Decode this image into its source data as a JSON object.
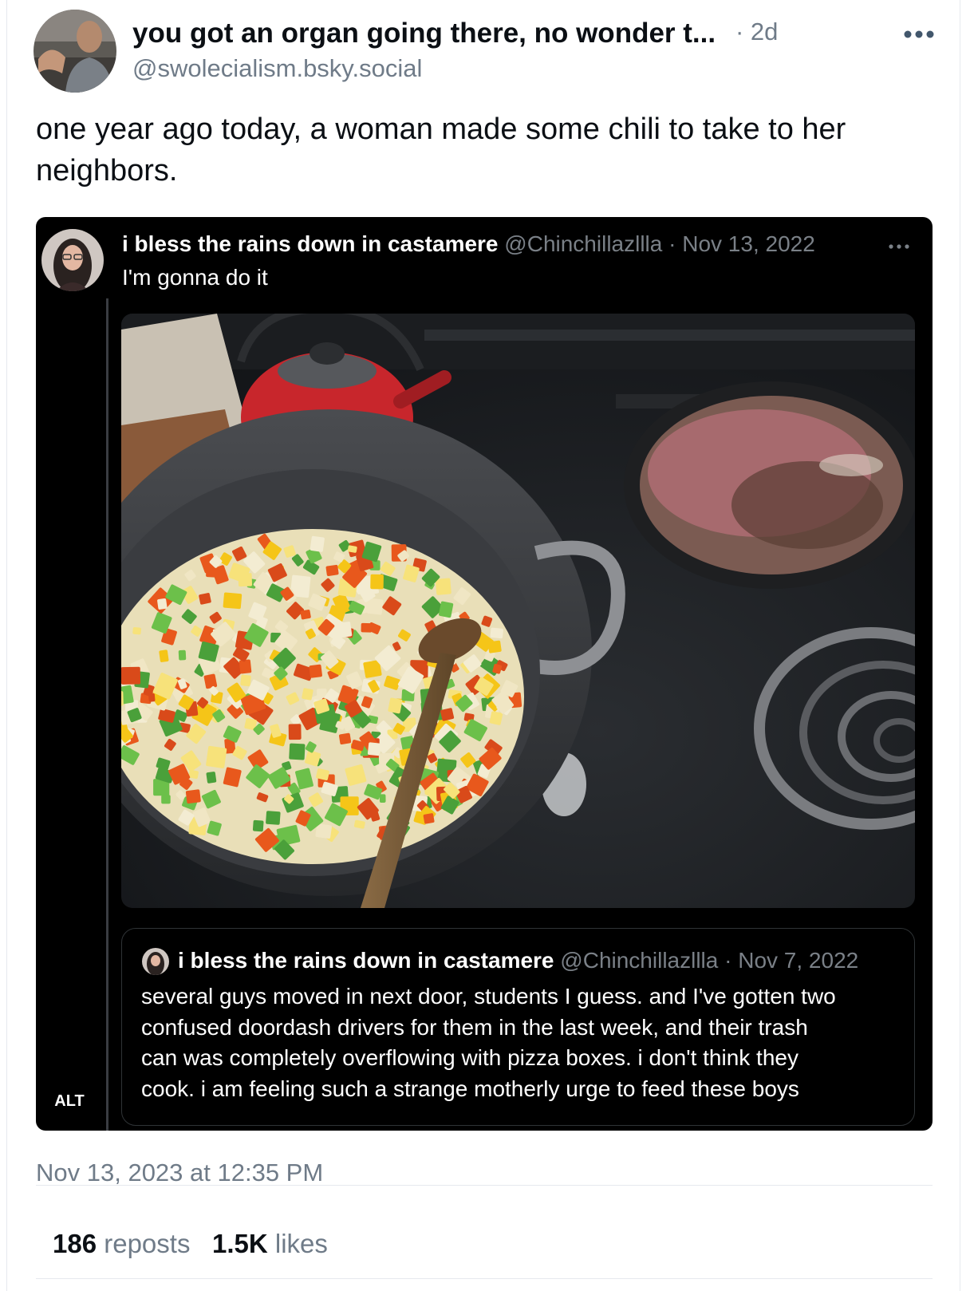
{
  "post": {
    "author_name": "you got an organ going there, no wonder t...",
    "age": "· 2d",
    "handle": "@swolecialism.bsky.social",
    "text": "one year ago today, a woman made some chili to take to her neighbors.",
    "timestamp": "Nov 13, 2023 at 12:35 PM",
    "more_icon": "ellipsis-icon"
  },
  "embed": {
    "name": "i bless the rains down in castamere",
    "meta": "@Chinchillazllla · Nov 13, 2022",
    "text": "I'm gonna do it",
    "alt_label": "ALT",
    "photo_alt": "pot of diced onions and peppers with a wooden spoon next to a skillet of browning ground beef on a stove",
    "quote": {
      "name": "i bless the rains down in castamere",
      "meta": "@Chinchillazllla · Nov 7, 2022",
      "lines": [
        "several guys moved in next door, students I guess. and I've gotten two",
        "confused doordash drivers for them in the last week, and their trash",
        "can was completely overflowing with pizza boxes. i don't think they",
        "cook. i am feeling such a strange motherly urge to feed these boys"
      ]
    }
  },
  "stats": {
    "reposts_count": "186",
    "reposts_label": "reposts",
    "likes_count": "1.5K",
    "likes_label": "likes"
  },
  "colors": {
    "text": "#0b0f14",
    "muted": "#6f7b88",
    "divider": "#e6e9ee",
    "embed_bg": "#000000"
  }
}
